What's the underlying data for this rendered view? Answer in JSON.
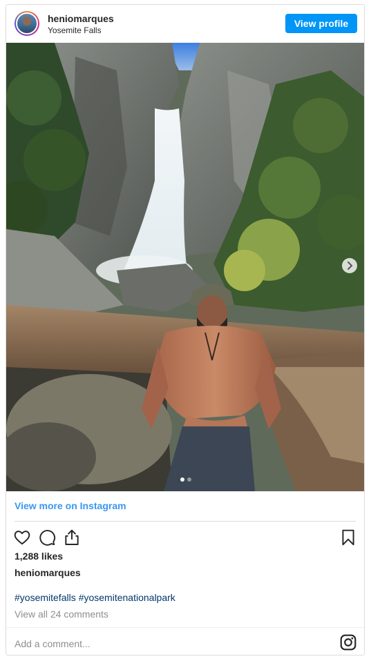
{
  "post": {
    "author": {
      "username": "heniomarques",
      "location": "Yosemite Falls"
    },
    "view_profile_label": "View profile",
    "photo": {
      "description_icon": "photo-image",
      "carousel": {
        "count": 2,
        "active_index": 0
      }
    },
    "view_more_label": "View more on Instagram",
    "likes_text": "1,288 likes",
    "caption_username": "heniomarques",
    "hashtags": [
      "#yosemitefalls",
      "#yosemitenationalpark"
    ],
    "view_comments_label": "View all 24 comments",
    "add_comment_placeholder": "Add a comment...",
    "icons": {
      "like": "heart-icon",
      "comment": "comment-icon",
      "share": "share-icon",
      "save": "bookmark-icon",
      "instagram": "instagram-icon",
      "next": "chevron-right-icon"
    },
    "colors": {
      "accent": "#0095f6",
      "link": "#3897f0",
      "hashtag": "#00376b",
      "muted": "#8e8e8e",
      "border": "#dbdbdb"
    }
  }
}
